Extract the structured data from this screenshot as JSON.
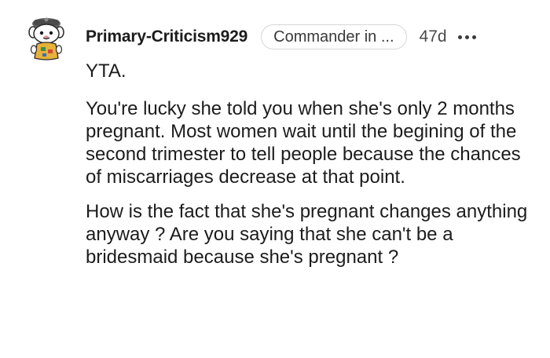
{
  "comment": {
    "author": "Primary-Criticism929",
    "flair": "Commander in ...",
    "age": "47d",
    "avatar_icon": "snoo-avatar-icon",
    "more_icon": "more-options-icon",
    "paragraphs": [
      "YTA.",
      "You're lucky she told you when she's only 2 months pregnant. Most women wait until the begining of the second trimester to tell people because the chances of miscarriages decrease at that point.",
      "How is the fact that she's pregnant changes anything anyway ? Are you saying that she can't be a bridesmaid because she's pregnant ?"
    ]
  }
}
